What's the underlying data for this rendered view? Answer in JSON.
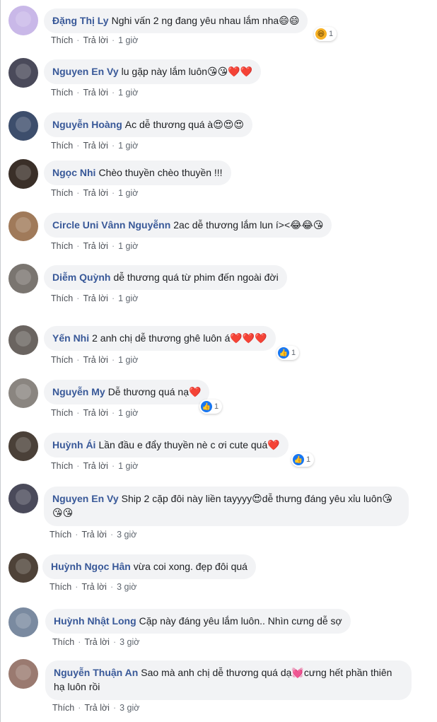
{
  "labels": {
    "like": "Thích",
    "reply": "Trả lời",
    "dot": "·"
  },
  "comments": [
    {
      "name": "Đặng Thị Ly",
      "text": "Nghi vấn 2 ng đang yêu nhau lắm nha",
      "emoji": "😄😄",
      "time": "1 giờ",
      "reaction": {
        "icon": "haha",
        "count": "1"
      },
      "avatar_color": "#c9b8e8"
    },
    {
      "name": "Nguyen En Vy",
      "text": "lu gặp này lắm luôn",
      "emoji": "😘😘❤️❤️",
      "time": "1 giờ",
      "avatar_color": "#4a4a5a"
    },
    {
      "name": "Nguyễn Hoàng",
      "text": "Ac dễ thương quá à",
      "emoji": "😍😍😍",
      "time": "1 giờ",
      "avatar_color": "#3d4e6c"
    },
    {
      "name": "Ngọc Nhi",
      "text": "Chèo thuyền chèo thuyền !!!",
      "emoji": "",
      "time": "1 giờ",
      "avatar_color": "#3a2f28"
    },
    {
      "name": "Circle Uni Vânn Nguyễnn",
      "text": "2ac dễ thương lắm lun í><",
      "emoji": "😂😂😘",
      "time": "1 giờ",
      "avatar_color": "#a07a5a"
    },
    {
      "name": "Diễm Quỳnh",
      "text": "dễ thương quá từ phim đến ngoài đời",
      "emoji": "",
      "time": "1 giờ",
      "avatar_color": "#7a7570"
    },
    {
      "name": "Yến Nhi",
      "text": "2 anh chị dễ thương ghê luôn á",
      "emoji": "❤️❤️❤️",
      "time": "1 giờ",
      "reaction": {
        "icon": "like",
        "count": "1"
      },
      "avatar_color": "#6a6460"
    },
    {
      "name": "Nguyễn My",
      "text": "Dễ thương quá nạ",
      "emoji": "❤️",
      "time": "1 giờ",
      "reaction": {
        "icon": "like",
        "count": "1"
      },
      "avatar_color": "#8a8580"
    },
    {
      "name": "Huỳnh Ái",
      "text": "Lần đầu e đẩy thuyền nè c ơi cute quá",
      "emoji": "❤️",
      "time": "1 giờ",
      "reaction": {
        "icon": "like",
        "count": "1"
      },
      "avatar_color": "#4a4038"
    },
    {
      "name": "Nguyen En Vy",
      "text": "Ship 2 cặp đôi này liền tayyyy",
      "emoji_mid": "😍",
      "text2": "dễ thưng đáng yêu xỉu luôn",
      "emoji": "😘😘😘",
      "time": "3 giờ",
      "avatar_color": "#4a4a5a"
    },
    {
      "name": "Huỳnh Ngọc Hân",
      "text": "vừa coi xong. đẹp đôi quá",
      "emoji": "",
      "time": "3 giờ",
      "avatar_color": "#4e4238"
    },
    {
      "name": "Huỳnh Nhật Long",
      "text": "Cặp này đáng yêu lắm luôn.. Nhìn cưng dễ sợ",
      "emoji": "",
      "time": "3 giờ",
      "avatar_color": "#7a8aa0"
    },
    {
      "name": "Nguyễn Thuận An",
      "text": "Sao mà anh chị dễ thương quá dạ",
      "emoji_mid": "💓",
      "text2": "cưng hết phần thiên hạ luôn rồi",
      "emoji": "",
      "time": "3 giờ",
      "avatar_color": "#9a7a70"
    }
  ]
}
